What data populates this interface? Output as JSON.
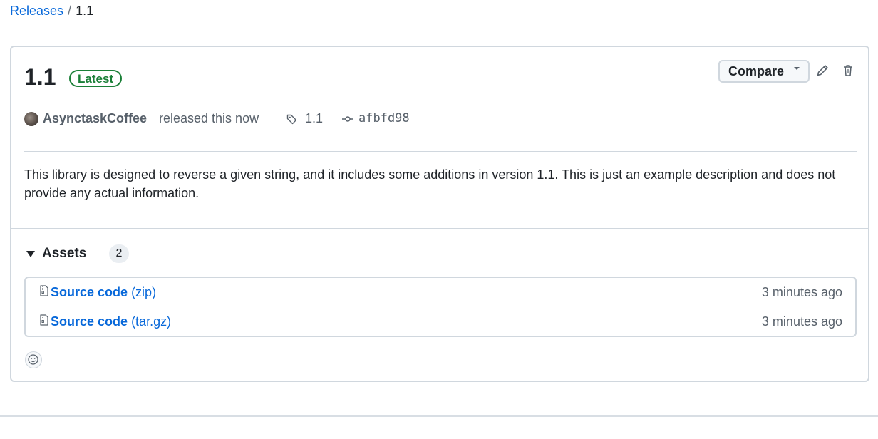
{
  "breadcrumb": {
    "parent": "Releases",
    "separator": "/",
    "current": "1.1"
  },
  "release": {
    "title": "1.1",
    "badge": "Latest",
    "author": "AsynctaskCoffee",
    "released_text": "released this now",
    "tag": "1.1",
    "commit": "afbfd98",
    "description": "This library is designed to reverse a given string, and it includes some additions in version 1.1. This is just an example description and does not provide any actual information."
  },
  "toolbar": {
    "compare_label": "Compare",
    "edit_icon": "pencil-icon",
    "delete_icon": "trash-icon"
  },
  "assets": {
    "title": "Assets",
    "count": "2",
    "items": [
      {
        "name": "Source code",
        "ext": "(zip)",
        "time": "3 minutes ago",
        "icon": "file-zip-icon"
      },
      {
        "name": "Source code",
        "ext": "(tar.gz)",
        "time": "3 minutes ago",
        "icon": "file-zip-icon"
      }
    ]
  },
  "colors": {
    "link": "#0969da",
    "badge_green": "#1a7f37",
    "border": "#d0d7de",
    "muted": "#57606a"
  }
}
